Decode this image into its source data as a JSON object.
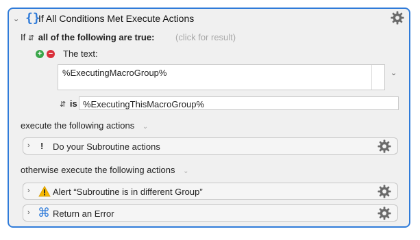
{
  "header": {
    "title": "If All Conditions Met Execute Actions",
    "icon": "braces-icon",
    "braces": "{}"
  },
  "condition": {
    "if_label": "If",
    "match_mode": "all of the following are true:",
    "result_hint": "(click for result)",
    "text_label": "The text:",
    "text_value": "%ExecutingMacroGroup%",
    "operator": "is",
    "compare_value": "%ExecutingThisMacroGroup%"
  },
  "then_section": {
    "label": "execute the following actions",
    "actions": [
      {
        "label": "Do your Subroutine actions",
        "icon": "exclamation-icon",
        "glyph": "!"
      }
    ]
  },
  "else_section": {
    "label": "otherwise execute the following actions",
    "actions": [
      {
        "label": "Alert “Subroutine is in different Group”",
        "icon": "warning-triangle-icon",
        "glyph": "!"
      },
      {
        "label": "Return an Error",
        "icon": "command-key-icon",
        "glyph": "⌘"
      }
    ]
  },
  "colors": {
    "accent": "#2f7bd9",
    "add_button": "#3aa64a",
    "remove_button": "#d9303b",
    "warning": "#f5b700"
  }
}
